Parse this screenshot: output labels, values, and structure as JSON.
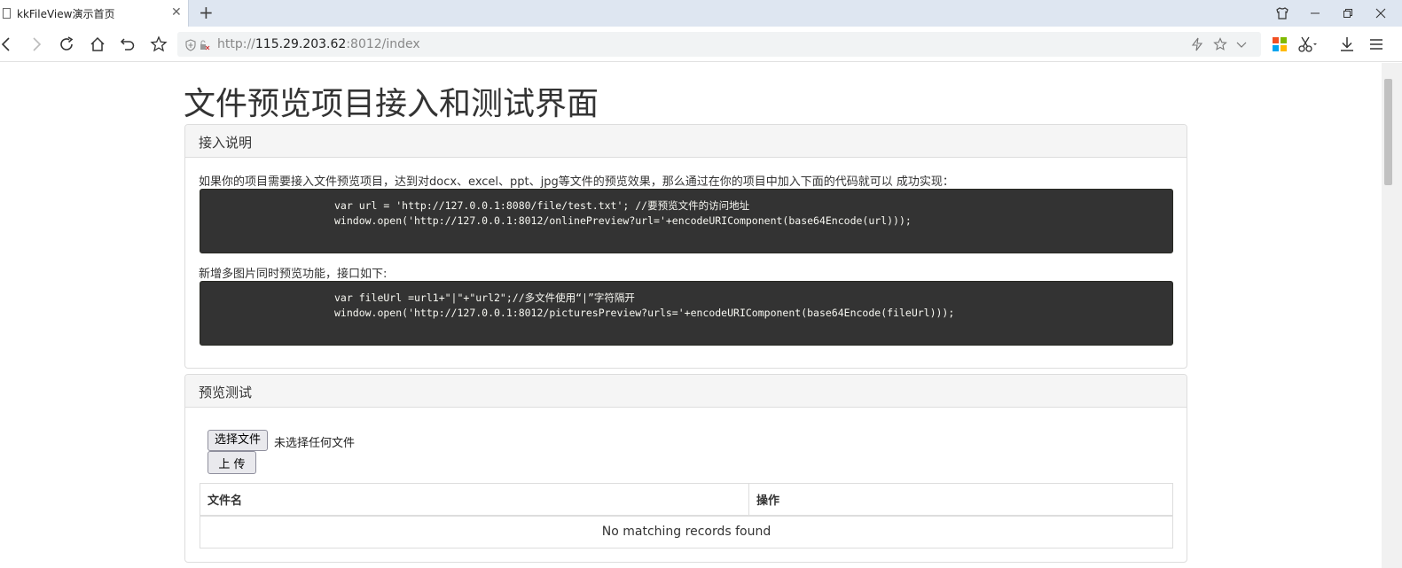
{
  "browser": {
    "tab_title": "kkFileView演示首页",
    "address": {
      "scheme": "http://",
      "host": "115.29.203.62",
      "path": ":8012/index"
    }
  },
  "page": {
    "title": "文件预览项目接入和测试界面"
  },
  "integration_panel": {
    "heading": "接入说明",
    "intro": "如果你的项目需要接入文件预览项目，达到对docx、excel、ppt、jpg等文件的预览效果，那么通过在你的项目中加入下面的代码就可以 成功实现：",
    "code1": {
      "line1": "var url = 'http://127.0.0.1:8080/file/test.txt'; //要预览文件的访问地址",
      "line2": "window.open('http://127.0.0.1:8012/onlinePreview?url='+encodeURIComponent(base64Encode(url)));"
    },
    "multi_intro": "新增多图片同时预览功能，接口如下:",
    "code2": {
      "line1": "var fileUrl =url1+\"|\"+\"url2\";//多文件使用“|”字符隔开",
      "line2": "window.open('http://127.0.0.1:8012/picturesPreview?urls='+encodeURIComponent(base64Encode(fileUrl)));"
    }
  },
  "test_panel": {
    "heading": "预览测试",
    "choose_file_label": "选择文件",
    "file_status": "未选择任何文件",
    "upload_label": "上 传",
    "table": {
      "columns": [
        "文件名",
        "操作"
      ],
      "empty_message": "No matching records found"
    }
  }
}
